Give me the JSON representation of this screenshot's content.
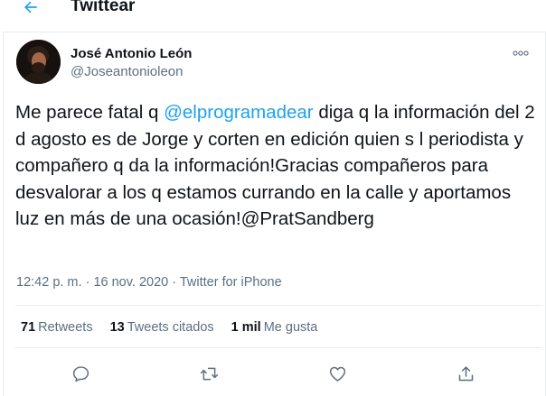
{
  "header": {
    "title": "Twittear",
    "back_icon": "arrow-left-icon",
    "accent": "#1da1f2"
  },
  "author": {
    "name": "José Antonio León",
    "handle": "@Joseantonioleon"
  },
  "tweet": {
    "text_before": "Me parece fatal q ",
    "mention_1": "@elprogramadear",
    "text_after": " diga q la información del 2 d agosto es de Jorge y corten en edición quien s l periodista y compañero q da la información!Gracias compañeros para desvalorar a los q estamos currando en la calle y aportamos luz en más de una ocasión!",
    "mention_2": "@PratSandberg"
  },
  "meta": {
    "time": "12:42 p. m.",
    "separator": " · ",
    "date": "16 nov. 2020",
    "source": "Twitter for iPhone"
  },
  "stats": {
    "retweets_count": "71",
    "retweets_label": "Retweets",
    "quotes_count": "13",
    "quotes_label": "Tweets citados",
    "likes_count": "1 mil",
    "likes_label": "Me gusta"
  },
  "actions": [
    "reply-icon",
    "retweet-icon",
    "like-icon",
    "share-icon"
  ],
  "colors": {
    "text": "#0f1419",
    "secondary": "#5b7083",
    "link": "#1da1f2",
    "border": "#e6ecf0"
  }
}
